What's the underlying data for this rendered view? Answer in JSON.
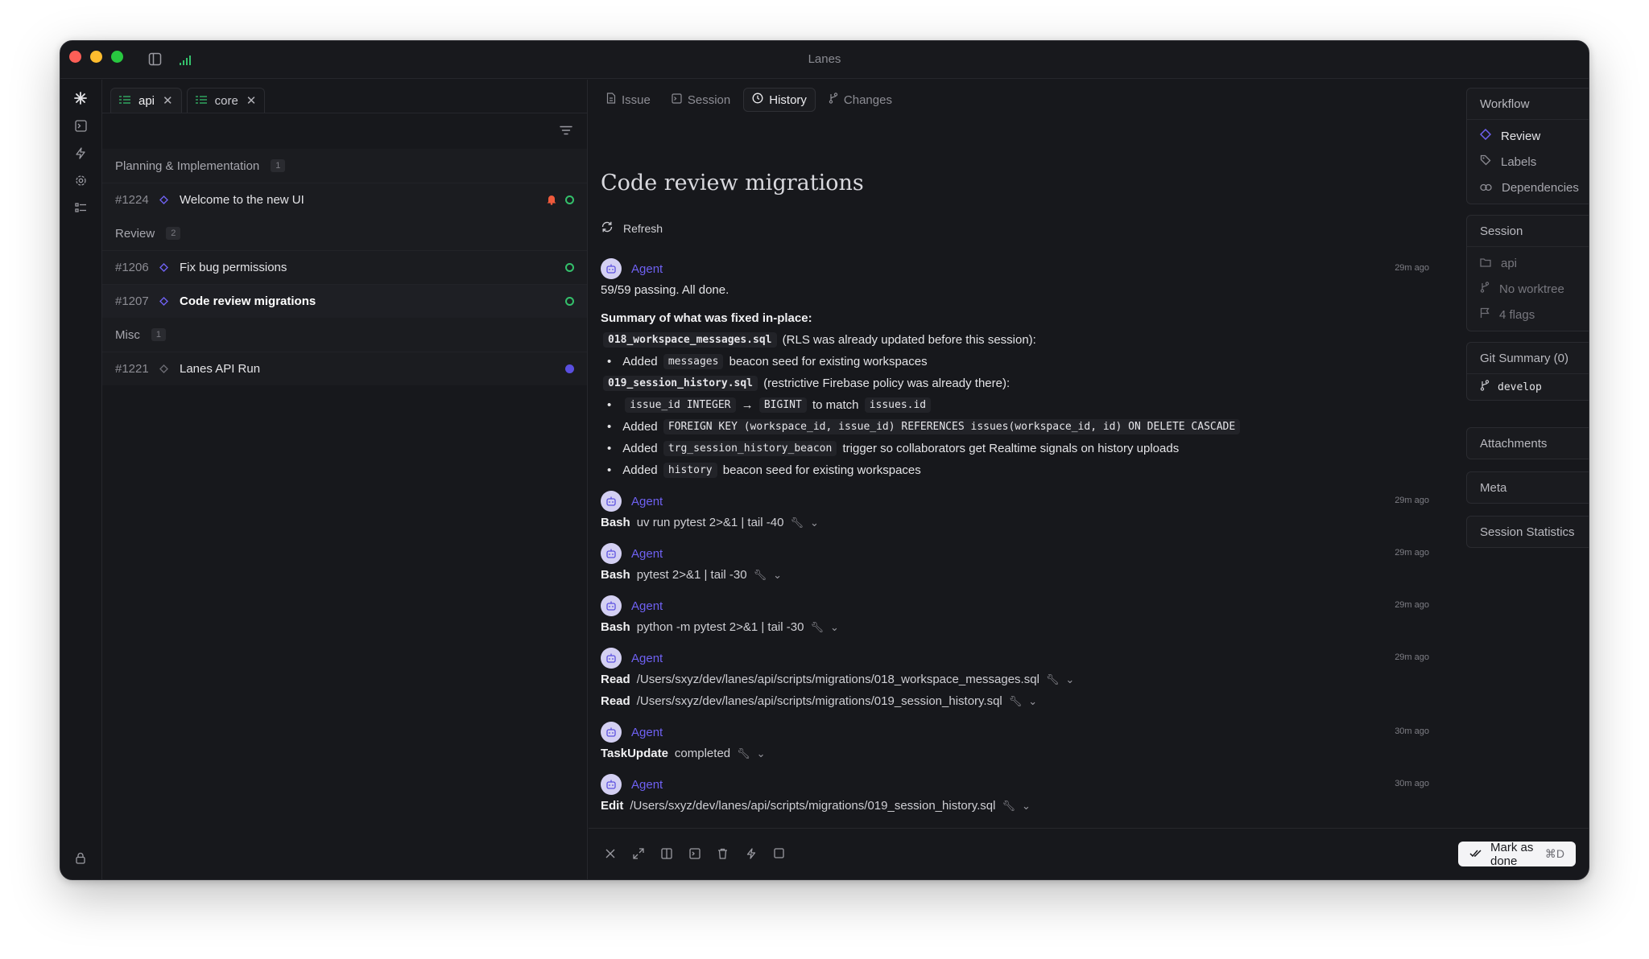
{
  "window": {
    "title": "Lanes"
  },
  "sidebar": {
    "tabs": [
      {
        "label": "api"
      },
      {
        "label": "core"
      }
    ],
    "groups": [
      {
        "name": "Planning & Implementation",
        "count": "1",
        "items": [
          {
            "num": "#1224",
            "title": "Welcome to the new UI"
          }
        ]
      },
      {
        "name": "Review",
        "count": "2",
        "items": [
          {
            "num": "#1206",
            "title": "Fix bug permissions"
          },
          {
            "num": "#1207",
            "title": "Code review migrations"
          }
        ]
      },
      {
        "name": "Misc",
        "count": "1",
        "items": [
          {
            "num": "#1221",
            "title": "Lanes API Run"
          }
        ]
      }
    ]
  },
  "main": {
    "tabs": [
      {
        "label": "Issue"
      },
      {
        "label": "Session"
      },
      {
        "label": "History"
      },
      {
        "label": "Changes"
      }
    ],
    "title": "Code review migrations",
    "refresh_label": "Refresh",
    "messages": [
      {
        "agent": "Agent",
        "time": "29m ago",
        "summary": "59/59 passing. All done.",
        "heading": "Summary of what was fixed in-place:",
        "file1": "018_workspace_messages.sql",
        "file1_note": "(RLS was already updated before this session):",
        "b1_pre": "Added",
        "b1_code": "messages",
        "b1_post": "beacon seed for existing workspaces",
        "file2": "019_session_history.sql",
        "file2_note": "(restrictive Firebase policy was already there):",
        "b2_code1": "issue_id INTEGER",
        "b2_arrow": "→",
        "b2_code2": "BIGINT",
        "b2_mid": "to match",
        "b2_code3": "issues.id",
        "b3_pre": "Added",
        "b3_code": "FOREIGN KEY (workspace_id, issue_id) REFERENCES issues(workspace_id, id) ON DELETE CASCADE",
        "b4_pre": "Added",
        "b4_code": "trg_session_history_beacon",
        "b4_post": "trigger so collaborators get Realtime signals on history uploads",
        "b5_pre": "Added",
        "b5_code": "history",
        "b5_post": "beacon seed for existing workspaces"
      },
      {
        "agent": "Agent",
        "time": "29m ago",
        "tools": [
          {
            "name": "Bash",
            "arg": "uv run pytest 2>&1 | tail -40"
          }
        ]
      },
      {
        "agent": "Agent",
        "time": "29m ago",
        "tools": [
          {
            "name": "Bash",
            "arg": "pytest 2>&1 | tail -30"
          }
        ]
      },
      {
        "agent": "Agent",
        "time": "29m ago",
        "tools": [
          {
            "name": "Bash",
            "arg": "python -m pytest 2>&1 | tail -30"
          }
        ]
      },
      {
        "agent": "Agent",
        "time": "29m ago",
        "tools": [
          {
            "name": "Read",
            "arg": "/Users/sxyz/dev/lanes/api/scripts/migrations/018_workspace_messages.sql"
          },
          {
            "name": "Read",
            "arg": "/Users/sxyz/dev/lanes/api/scripts/migrations/019_session_history.sql"
          }
        ]
      },
      {
        "agent": "Agent",
        "time": "30m ago",
        "tools": [
          {
            "name": "TaskUpdate",
            "arg": "completed"
          }
        ]
      },
      {
        "agent": "Agent",
        "time": "30m ago",
        "tools": [
          {
            "name": "Edit",
            "arg": "/Users/sxyz/dev/lanes/api/scripts/migrations/019_session_history.sql"
          }
        ]
      }
    ]
  },
  "right": {
    "workflow": {
      "title": "Workflow",
      "items": [
        "Review",
        "Labels",
        "Dependencies"
      ]
    },
    "session": {
      "title": "Session",
      "items": [
        "api",
        "No worktree",
        "4 flags"
      ]
    },
    "git": {
      "title": "Git Summary (0)",
      "branch": "develop"
    },
    "attachments": {
      "title": "Attachments"
    },
    "meta": {
      "title": "Meta"
    },
    "stats": {
      "title": "Session Statistics"
    },
    "mark_done": {
      "label": "Mark as done",
      "shortcut": "⌘D"
    }
  },
  "colors": {
    "accent": "#6f61f2",
    "status_green": "#34c06b",
    "bell": "#ef5a3c"
  }
}
